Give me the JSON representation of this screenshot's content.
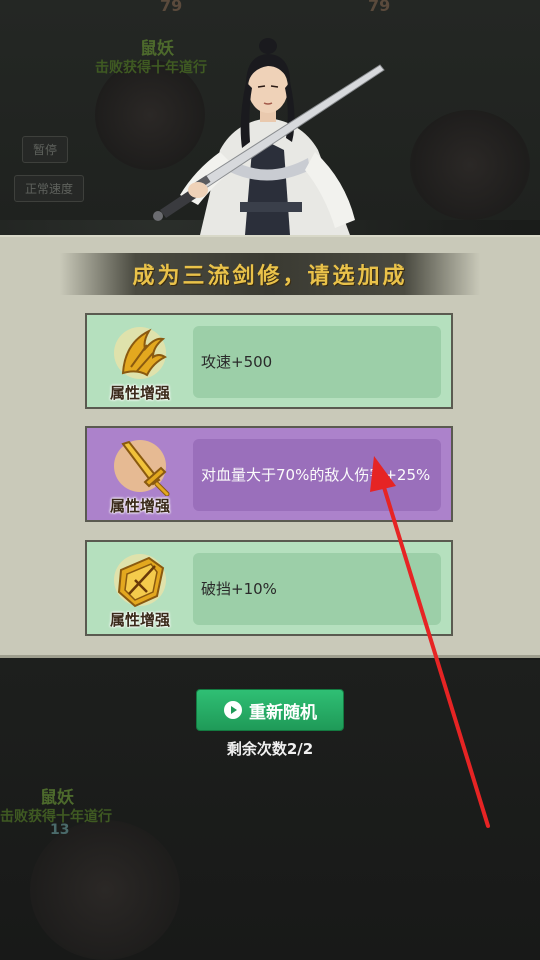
{
  "background": {
    "top_number_left": "79",
    "top_number_right": "79",
    "enemy_top_name": "鼠妖",
    "enemy_top_reward": "击败获得十年道行",
    "pause_button": "暂停",
    "speed_button": "正常速度",
    "enemy_bottom_name": "鼠妖",
    "enemy_bottom_reward": "击败获得十年道行",
    "enemy_bottom_number": "13"
  },
  "panel": {
    "title": "成为三流剑修，请选加成",
    "options": [
      {
        "category": "属性增强",
        "description": "攻速+500",
        "style": "green",
        "icon": "golden-claw-icon"
      },
      {
        "category": "属性增强",
        "description": "对血量大于70%的敌人伤害+25%",
        "style": "purple",
        "icon": "golden-sword-icon"
      },
      {
        "category": "属性增强",
        "description": "破挡+10%",
        "style": "green",
        "icon": "golden-shield-icon"
      }
    ]
  },
  "reroll": {
    "label": "重新随机",
    "icon": "play-icon",
    "remaining": "剩余次数2/2"
  },
  "colors": {
    "accent_title": "#e9c24a",
    "green_card": "#b5e0be",
    "purple_card": "#ac82cb",
    "reroll_button": "#25a865",
    "annotation_arrow": "#e62424"
  }
}
